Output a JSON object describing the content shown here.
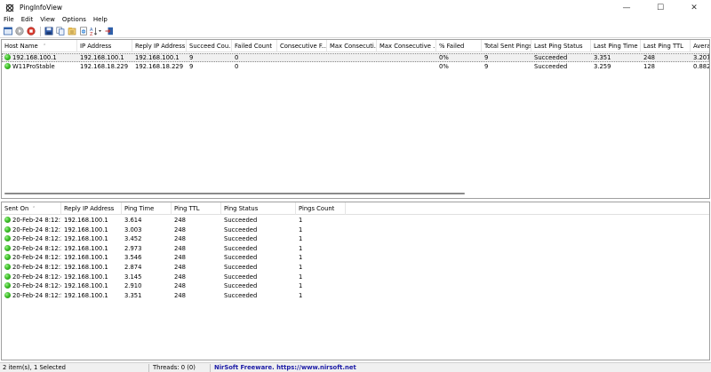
{
  "window": {
    "title": "PingInfoView",
    "minimize_glyph": "—",
    "maximize_glyph": "☐",
    "close_glyph": "✕"
  },
  "menu": [
    "File",
    "Edit",
    "View",
    "Options",
    "Help"
  ],
  "toolbar": {
    "buttons": [
      "options-icon",
      "start-icon",
      "stop-icon",
      "save-icon",
      "copy-icon",
      "properties-icon",
      "html-report-icon",
      "sort-icon",
      "exit-icon"
    ]
  },
  "top_table": {
    "columns": [
      "Host Name",
      "IP Address",
      "Reply IP Address",
      "Succeed Cou...",
      "Failed Count",
      "Consecutive F...",
      "Max Consecuti...",
      "Max Consecutive ...",
      "% Failed",
      "Total Sent Pings",
      "Last Ping Status",
      "Last Ping Time",
      "Last Ping TTL",
      "Averag"
    ],
    "rows": [
      [
        "192.168.100.1",
        "192.168.100.1",
        "192.168.100.1",
        "9",
        "0",
        "",
        "",
        "",
        "0%",
        "9",
        "Succeeded",
        "3.351",
        "248",
        "3.207"
      ],
      [
        "W11ProStable",
        "192.168.18.229",
        "192.168.18.229",
        "9",
        "0",
        "",
        "",
        "",
        "0%",
        "9",
        "Succeeded",
        "3.259",
        "128",
        "0.882"
      ]
    ]
  },
  "bottom_table": {
    "columns": [
      "Sent On",
      "Reply IP Address",
      "Ping Time",
      "Ping TTL",
      "Ping Status",
      "Pings Count"
    ],
    "rows": [
      [
        "20-Feb-24 8:12:1...",
        "192.168.100.1",
        "3.614",
        "248",
        "Succeeded",
        "1"
      ],
      [
        "20-Feb-24 8:12:1...",
        "192.168.100.1",
        "3.003",
        "248",
        "Succeeded",
        "1"
      ],
      [
        "20-Feb-24 8:12:2...",
        "192.168.100.1",
        "3.452",
        "248",
        "Succeeded",
        "1"
      ],
      [
        "20-Feb-24 8:12:2...",
        "192.168.100.1",
        "2.973",
        "248",
        "Succeeded",
        "1"
      ],
      [
        "20-Feb-24 8:12:3...",
        "192.168.100.1",
        "3.546",
        "248",
        "Succeeded",
        "1"
      ],
      [
        "20-Feb-24 8:12:3...",
        "192.168.100.1",
        "2.874",
        "248",
        "Succeeded",
        "1"
      ],
      [
        "20-Feb-24 8:12:4...",
        "192.168.100.1",
        "3.145",
        "248",
        "Succeeded",
        "1"
      ],
      [
        "20-Feb-24 8:12:4...",
        "192.168.100.1",
        "2.910",
        "248",
        "Succeeded",
        "1"
      ],
      [
        "20-Feb-24 8:12:5...",
        "192.168.100.1",
        "3.351",
        "248",
        "Succeeded",
        "1"
      ]
    ]
  },
  "status": {
    "selection": "2 item(s), 1 Selected",
    "threads": "Threads: 0 (0)",
    "link": "NirSoft Freeware. https://www.nirsoft.net"
  },
  "colors": {
    "status_ok": "#3fbf2a",
    "link": "#1a1aa6"
  }
}
